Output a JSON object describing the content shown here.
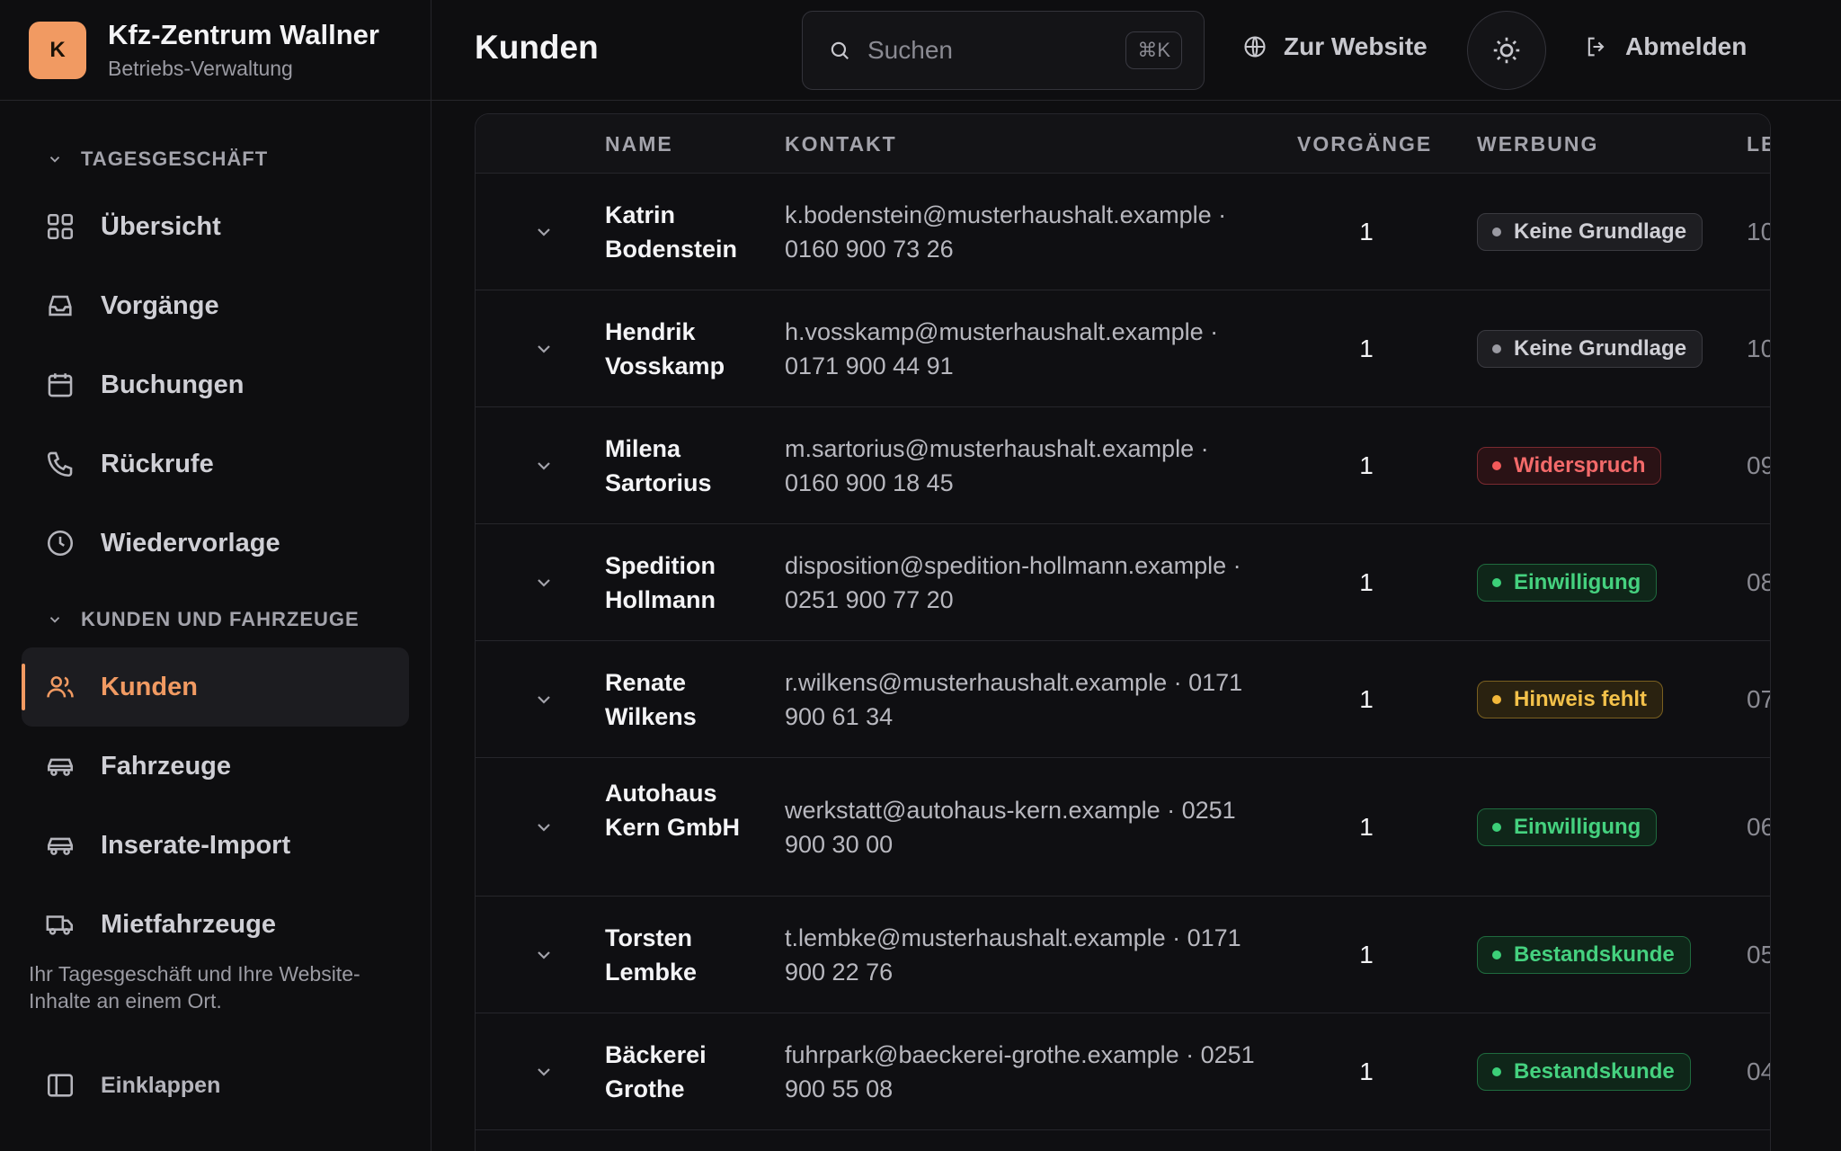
{
  "brand": {
    "logo_letter": "K",
    "title": "Kfz-Zentrum Wallner",
    "subtitle": "Betriebs-Verwaltung"
  },
  "sidebar": {
    "sections": [
      {
        "label": "TAGESGESCHÄFT",
        "items": [
          {
            "label": "Übersicht",
            "icon": "grid-icon"
          },
          {
            "label": "Vorgänge",
            "icon": "inbox-icon"
          },
          {
            "label": "Buchungen",
            "icon": "calendar-icon"
          },
          {
            "label": "Rückrufe",
            "icon": "phone-icon"
          },
          {
            "label": "Wiedervorlage",
            "icon": "clock-icon"
          }
        ]
      },
      {
        "label": "KUNDEN UND FAHRZEUGE",
        "items": [
          {
            "label": "Kunden",
            "icon": "users-icon",
            "active": true
          },
          {
            "label": "Fahrzeuge",
            "icon": "car-icon"
          },
          {
            "label": "Inserate-Import",
            "icon": "car-icon"
          },
          {
            "label": "Mietfahrzeuge",
            "icon": "truck-icon"
          }
        ]
      }
    ],
    "note": "Ihr Tagesgeschäft und Ihre Website-Inhalte an einem Ort.",
    "collapse_label": "Einklappen"
  },
  "header": {
    "title": "Kunden",
    "search_placeholder": "Suchen",
    "search_shortcut": "⌘K",
    "website_link": "Zur Website",
    "logout": "Abmelden"
  },
  "table": {
    "columns": {
      "name": "NAME",
      "contact": "KONTAKT",
      "cases": "VORGÄNGE",
      "ads": "WERBUNG",
      "last": "LE"
    },
    "rows": [
      {
        "name": "Katrin Bodenstein",
        "contact": "k.bodenstein@musterhaushalt.example · 0160 900 73 26",
        "cases": "1",
        "ads": "Keine Grundlage",
        "ads_tone": "gray",
        "last": "10"
      },
      {
        "name": "Hendrik Vosskamp",
        "contact": "h.vosskamp@musterhaushalt.example · 0171 900 44 91",
        "cases": "1",
        "ads": "Keine Grundlage",
        "ads_tone": "gray",
        "last": "10"
      },
      {
        "name": "Milena Sartorius",
        "contact": "m.sartorius@musterhaushalt.example · 0160 900 18 45",
        "cases": "1",
        "ads": "Widerspruch",
        "ads_tone": "red",
        "last": "09"
      },
      {
        "name": "Spedition Hollmann",
        "contact": "disposition@spedition-hollmann.example · 0251 900 77 20",
        "cases": "1",
        "ads": "Einwilligung",
        "ads_tone": "green",
        "last": "08"
      },
      {
        "name": "Renate Wilkens",
        "contact": "r.wilkens@musterhaushalt.example · 0171 900 61 34",
        "cases": "1",
        "ads": "Hinweis fehlt",
        "ads_tone": "amber",
        "last": "07"
      },
      {
        "name": "Autohaus Kern GmbH",
        "contact": "werkstatt@autohaus-kern.example · 0251 900 30 00",
        "cases": "1",
        "ads": "Einwilligung",
        "ads_tone": "green",
        "last": "06"
      },
      {
        "name": "Torsten Lembke",
        "contact": "t.lembke@musterhaushalt.example · 0171 900 22 76",
        "cases": "1",
        "ads": "Bestandskunde",
        "ads_tone": "green",
        "last": "05"
      },
      {
        "name": "Bäckerei Grothe",
        "contact": "fuhrpark@baeckerei-grothe.example · 0251 900 55 08",
        "cases": "1",
        "ads": "Bestandskunde",
        "ads_tone": "green",
        "last": "04"
      }
    ]
  }
}
